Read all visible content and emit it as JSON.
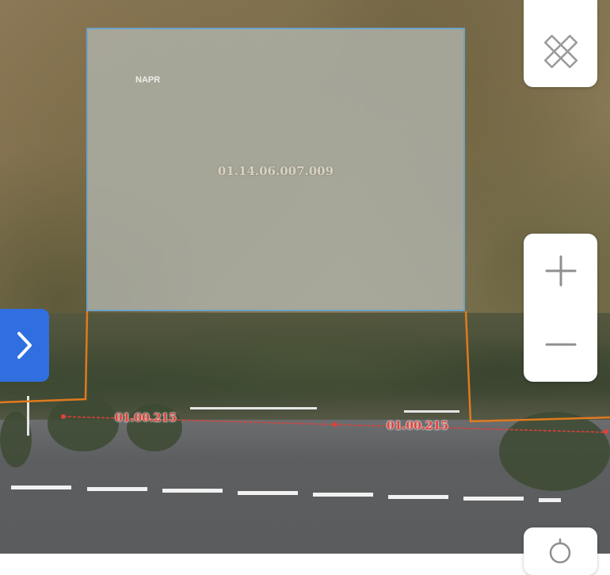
{
  "map": {
    "parcel": {
      "id_label": "01.14.06.007.009",
      "watermark": "NAPR"
    },
    "road_labels": [
      "01.00.215",
      "01.00.215"
    ]
  },
  "controls": {
    "expand_sidebar": "chevron-right-icon",
    "measure_tool": "ruler-pencil-icon",
    "zoom_in": "plus-icon",
    "zoom_out": "minus-icon",
    "locate": "location-icon"
  },
  "colors": {
    "parcel_border": "#6fa2c8",
    "boundary_line": "#e07a1f",
    "road_line": "#e0403a",
    "sidebar_button": "#2f6fe0"
  }
}
